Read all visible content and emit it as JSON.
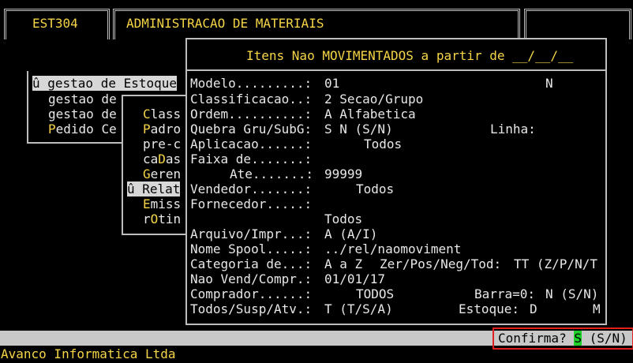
{
  "header": {
    "program_code": "EST304",
    "system_title": "ADMINISTRACAO DE MATERIAIS"
  },
  "main_menu": {
    "items": [
      {
        "prefix": "û ",
        "label": "gestao de Estoque",
        "selected": true
      },
      {
        "label": "gestao de"
      },
      {
        "label": "gestao de"
      },
      {
        "hot": "P",
        "rest": "edido Ce"
      }
    ]
  },
  "submenu": {
    "items": [
      {
        "hot": "C",
        "rest": "lass"
      },
      {
        "hot": "P",
        "rest": "adro"
      },
      {
        "pre": "pre-c",
        "hot": "",
        "rest": ""
      },
      {
        "pre": "ca",
        "hot": "D",
        "rest": "as"
      },
      {
        "hot": "G",
        "rest": "eren"
      },
      {
        "label": "û Relat",
        "selected": true
      },
      {
        "hot": "E",
        "rest": "miss"
      },
      {
        "pre": "r",
        "hot": "O",
        "rest": "tin"
      }
    ]
  },
  "dialog": {
    "title": "Itens Nao MOVIMENTADOS a partir de __/__/__",
    "fields": {
      "modelo_label": "Modelo.........:",
      "modelo_value": "01",
      "modelo_extra": "N",
      "classificacao_label": "Classificacao..:",
      "classificacao_value": "2 Secao/Grupo",
      "ordem_label": "Ordem..........:",
      "ordem_value": "A Alfabetica",
      "quebra_label": "Quebra Gru/SubG:",
      "quebra_value": "S N (S/N)",
      "linha_label": "Linha:",
      "aplicacao_label": "Aplicacao......:",
      "aplicacao_value": "Todos",
      "faixa_label": "Faixa de.......:",
      "ate_label": "Ate.......:",
      "ate_value": "99999",
      "vendedor_label": "Vendedor.......:",
      "vendedor_value": "Todos",
      "fornecedor_label": "Fornecedor.....:",
      "fornecedor_value": "Todos",
      "arquivo_label": "Arquivo/Impr...:",
      "arquivo_value": "A (A/I)",
      "spool_label": "Nome Spool.....:",
      "spool_value": "../rel/naomoviment",
      "categoria_label": "Categoria de...:",
      "categoria_value": "A a Z",
      "zer_label": "Zer/Pos/Neg/Tod:",
      "zer_value": "TT (Z/P/N/T",
      "naovend_label": "Nao Vend/Compr.:",
      "naovend_value": "01/01/17",
      "comprador_label": "Comprador......:",
      "comprador_value": "TODOS",
      "barra_label": "Barra=0:",
      "barra_value": "N (S/N)",
      "todos_label": "Todos/Susp/Atv.:",
      "todos_value": "T (T/S/A)",
      "estoque_label": "Estoque:",
      "estoque_value": "D",
      "estoque_extra": "M"
    }
  },
  "status": {
    "confirm_label": "Confirma?",
    "confirm_value": "S",
    "confirm_options": "(S/N)",
    "company": "Avanco Informatica Ltda"
  },
  "colors": {
    "text_yellow": "#f5d547",
    "highlight": "#d7d7d7",
    "confirm_green": "#1fd12a",
    "confirm_border": "#e0201f"
  }
}
